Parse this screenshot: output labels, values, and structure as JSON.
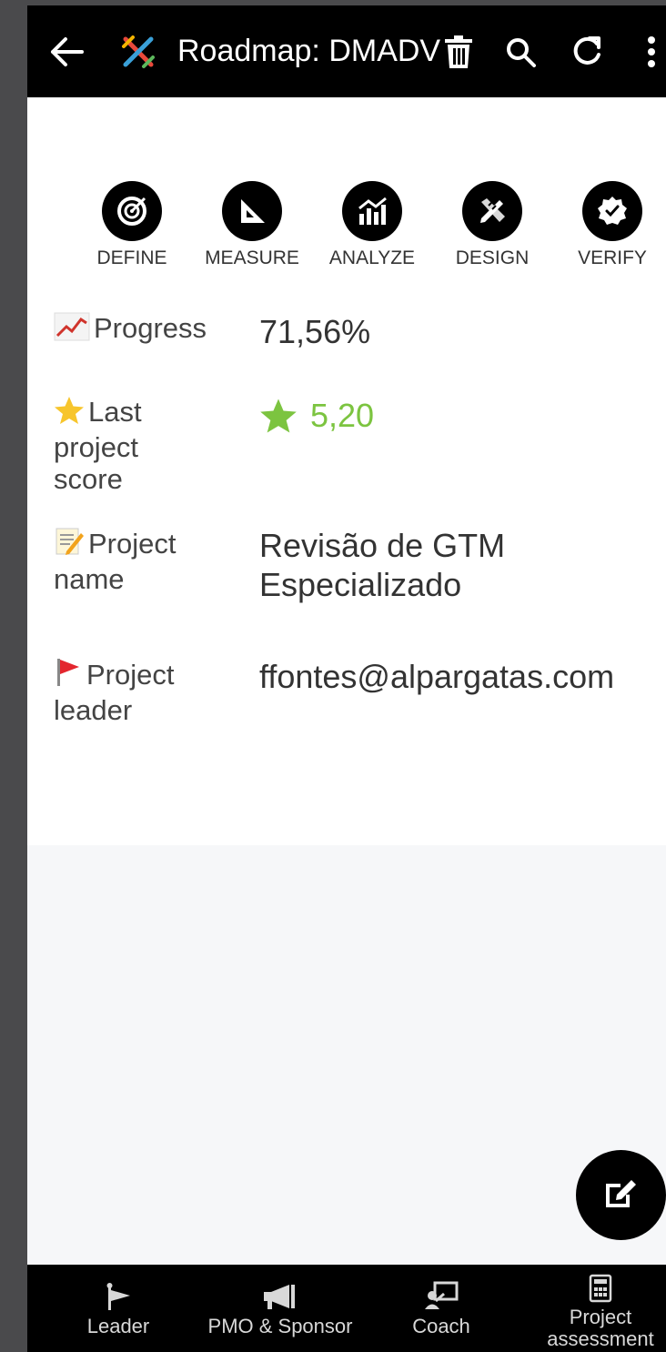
{
  "app_bar": {
    "title": "Roadmap: DMADV",
    "icons": [
      "back-arrow-icon",
      "app-logo-icon",
      "trash-icon",
      "search-icon",
      "refresh-icon",
      "more-vertical-icon"
    ]
  },
  "phases": [
    {
      "label": "DEFINE",
      "icon": "target-icon"
    },
    {
      "label": "MEASURE",
      "icon": "set-square-icon"
    },
    {
      "label": "ANALYZE",
      "icon": "chart-icon"
    },
    {
      "label": "DESIGN",
      "icon": "pencil-ruler-icon"
    },
    {
      "label": "VERIFY",
      "icon": "verified-badge-icon"
    }
  ],
  "fields": {
    "progress": {
      "label": "Progress",
      "value": "71,56%"
    },
    "score": {
      "label": "Last project score",
      "label_line1": "Last",
      "label_line2": "project",
      "label_line3": "score",
      "value": "5,20"
    },
    "name": {
      "label": "Project name",
      "label_line1": "Project",
      "label_line2": "name",
      "value_line1": "Revisão de GTM",
      "value_line2": "Especializado"
    },
    "leader": {
      "label": "Project leader",
      "label_line1": "Project",
      "label_line2": "leader",
      "value": "ffontes@alpargatas.com"
    }
  },
  "colors": {
    "score_green": "#7cc440",
    "bar_bg": "#000000",
    "lower_bg": "#f6f7f9"
  },
  "fab": {
    "icon": "edit-icon"
  },
  "bottom_nav": [
    {
      "label": "Leader",
      "icon": "flag-icon"
    },
    {
      "label": "PMO & Sponsor",
      "icon": "megaphone-icon"
    },
    {
      "label": "Coach",
      "icon": "coach-board-icon"
    },
    {
      "label": "Project assessment",
      "label_line1": "Project",
      "label_line2": "assessment",
      "icon": "calculator-icon"
    }
  ]
}
